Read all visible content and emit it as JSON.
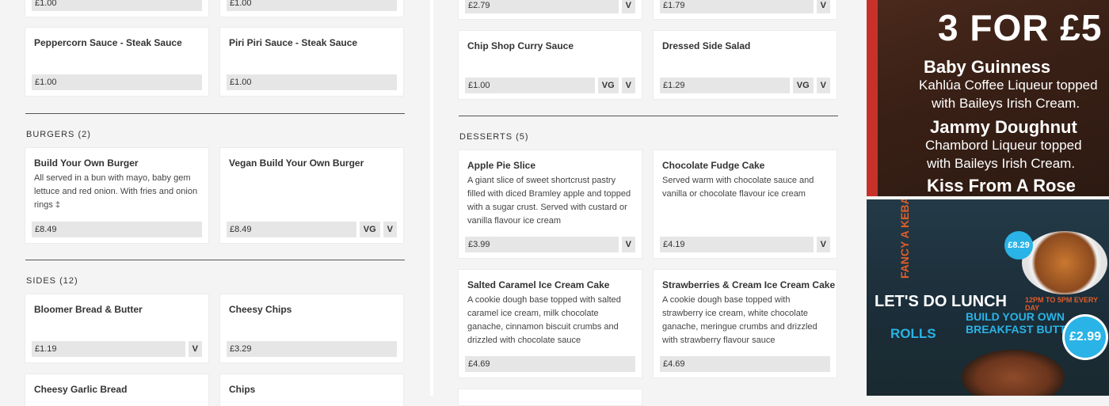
{
  "left": {
    "top_cards": [
      {
        "price": "£1.00"
      },
      {
        "price": "£1.00"
      }
    ],
    "sauces": [
      {
        "title": "Peppercorn Sauce - Steak Sauce",
        "price": "£1.00"
      },
      {
        "title": "Piri Piri Sauce - Steak Sauce",
        "price": "£1.00"
      }
    ],
    "burgers": {
      "heading": "BURGERS (2)",
      "items": [
        {
          "title": "Build Your Own Burger",
          "desc": "All served in a bun with mayo, baby gem lettuce and red onion. With fries and onion rings ‡",
          "price": "£8.49"
        },
        {
          "title": "Vegan Build Your Own Burger",
          "desc": "",
          "price": "£8.49",
          "tags": [
            "VG",
            "V"
          ]
        }
      ]
    },
    "sides": {
      "heading": "SIDES (12)",
      "items": [
        {
          "title": "Bloomer Bread & Butter",
          "price": "£1.19",
          "tags": [
            "V"
          ]
        },
        {
          "title": "Cheesy Chips",
          "price": "£3.29"
        },
        {
          "title": "Cheesy Garlic Bread"
        },
        {
          "title": "Chips"
        }
      ]
    }
  },
  "right": {
    "top_cards": [
      {
        "price": "£2.79",
        "tags": [
          "V"
        ]
      },
      {
        "price": "£1.79",
        "tags": [
          "V"
        ]
      }
    ],
    "row2": [
      {
        "title": "Chip Shop Curry Sauce",
        "price": "£1.00",
        "tags": [
          "VG",
          "V"
        ]
      },
      {
        "title": "Dressed Side Salad",
        "price": "£1.29",
        "tags": [
          "VG",
          "V"
        ]
      }
    ],
    "desserts": {
      "heading": "DESSERTS (5)",
      "items": [
        {
          "title": "Apple Pie Slice",
          "desc": "A giant slice of sweet shortcrust pastry filled with diced Bramley apple and topped with a sugar crust. Served with custard or vanilla flavour ice cream",
          "price": "£3.99",
          "tags": [
            "V"
          ]
        },
        {
          "title": "Chocolate Fudge Cake",
          "desc": "Served warm with chocolate sauce and vanilla or chocolate flavour ice cream",
          "price": "£4.19",
          "tags": [
            "V"
          ]
        },
        {
          "title": "Salted Caramel Ice Cream Cake",
          "desc": "A cookie dough base topped with salted caramel ice cream, milk chocolate ganache, cinnamon biscuit crumbs and drizzled with chocolate sauce",
          "price": "£4.69"
        },
        {
          "title": "Strawberries & Cream Ice Cream Cake",
          "desc": "A cookie dough base topped with strawberry ice cream, white chocolate ganache, meringue crumbs and drizzled with strawberry flavour sauce",
          "price": "£4.69"
        }
      ]
    }
  },
  "photos": {
    "photo1": {
      "big": "3 FOR £5",
      "item1_title": "Baby Guinness",
      "item1_line1": "Kahlúa Coffee Liqueur topped",
      "item1_line2": "with Baileys Irish Cream.",
      "item2_title": "Jammy Doughnut",
      "item2_line1": "Chambord Liqueur topped",
      "item2_line2": "with Baileys Irish Cream.",
      "item3_title": "Kiss From A Rose"
    },
    "photo2": {
      "lunch": "LET'S DO LUNCH",
      "time": "12PM TO 5PM EVERY DAY",
      "byo": "BUILD YOUR OWN BREAKFAST BUTTY",
      "rolls": "ROLLS",
      "kebab": "FANCY A KEBAB?",
      "price1": "£8.29",
      "price2": "£2.99"
    }
  }
}
